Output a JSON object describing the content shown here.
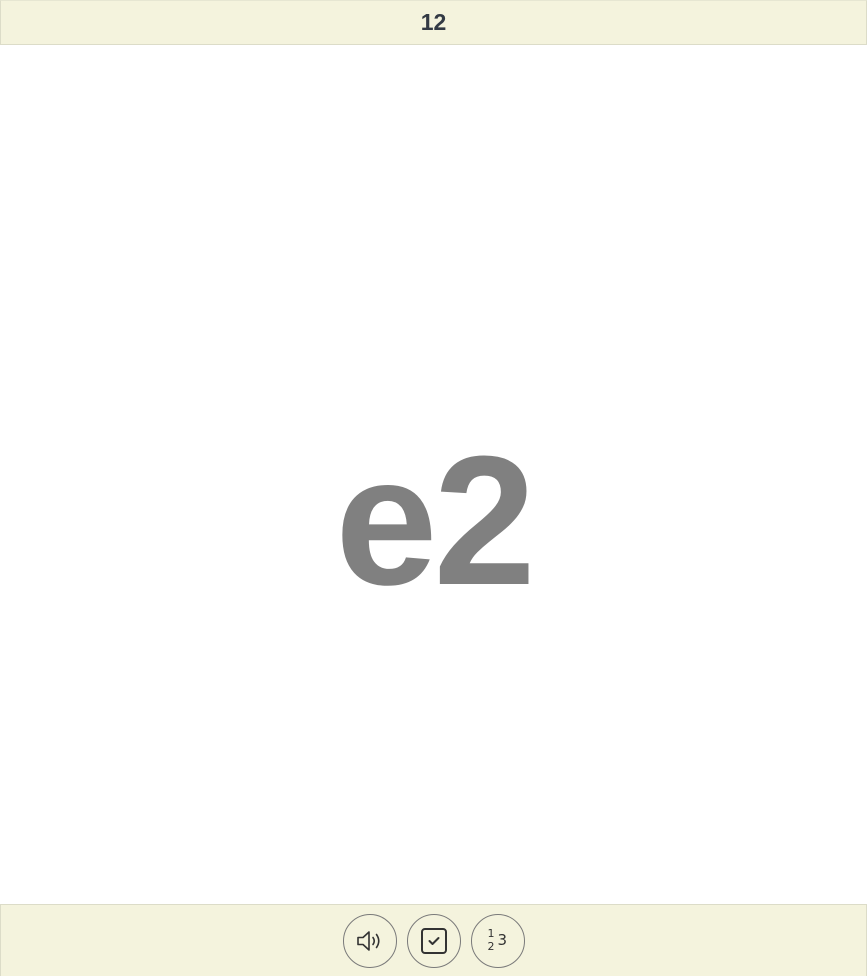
{
  "header": {
    "counter": "12"
  },
  "card": {
    "term": "e2"
  },
  "toolbar": {
    "buttons": [
      {
        "icon": "speaker-icon"
      },
      {
        "icon": "checkbox-icon"
      },
      {
        "icon": "numbers-icon",
        "glyphs": [
          "1",
          "2",
          "3"
        ]
      }
    ]
  },
  "colors": {
    "bar_background": "#f4f3dd",
    "term_color": "#808080",
    "counter_color": "#333a44"
  }
}
